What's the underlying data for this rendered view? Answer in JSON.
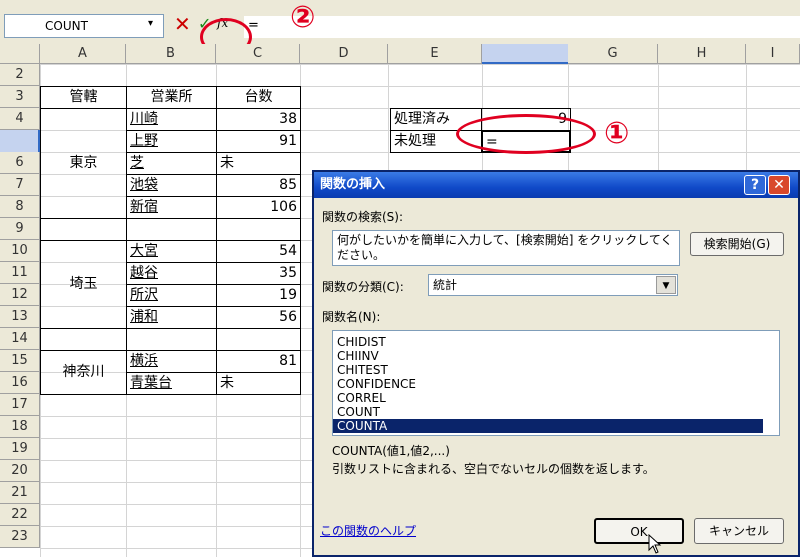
{
  "formula_bar": {
    "name_box": "COUNT",
    "dropdown_glyph": "▾",
    "cancel_glyph": "✕",
    "enter_glyph": "✓",
    "fx_label": "fx",
    "formula": "=",
    "marker": "②"
  },
  "columns": [
    "A",
    "B",
    "C",
    "D",
    "E",
    "F",
    "G",
    "H",
    "I"
  ],
  "rows": [
    "2",
    "3",
    "4",
    "5",
    "6",
    "7",
    "8",
    "9",
    "10",
    "11",
    "12",
    "13",
    "14",
    "15",
    "16",
    "17",
    "18",
    "19",
    "20",
    "21",
    "22",
    "23"
  ],
  "table": {
    "header_kankatsu": "管轄",
    "header_eigyosho": "営業所",
    "header_daisu": "台数",
    "region_tokyo": "東京",
    "region_saitama": "埼玉",
    "region_kanagawa": "神奈川",
    "office_1": "川崎",
    "count_1": "38",
    "office_2": "上野",
    "count_2": "91",
    "office_3": "芝",
    "count_3": "未",
    "office_4": "池袋",
    "count_4": "85",
    "office_5": "新宿",
    "count_5": "106",
    "office_6": "大宮",
    "count_6": "54",
    "office_7": "越谷",
    "count_7": "35",
    "office_8": "所沢",
    "count_8": "19",
    "office_9": "浦和",
    "count_9": "56",
    "office_10": "横浜",
    "count_10": "81",
    "office_11": "青葉台",
    "count_11": "未"
  },
  "summary": {
    "processed_label": "処理済み",
    "processed_value": "9",
    "unprocessed_label": "未処理",
    "unprocessed_value": "=",
    "marker": "①"
  },
  "dialog": {
    "title": "関数の挿入",
    "help_glyph": "?",
    "close_glyph": "✕",
    "search_label": "関数の検索(S):",
    "search_text": "何がしたいかを簡単に入力して、[検索開始] をクリックしてください。",
    "search_button": "検索開始(G)",
    "category_label": "関数の分類(C):",
    "category_value": "統計",
    "select_arrow": "▼",
    "func_name_label": "関数名(N):",
    "functions": [
      "CHIDIST",
      "CHIINV",
      "CHITEST",
      "CONFIDENCE",
      "CORREL",
      "COUNT",
      "COUNTA"
    ],
    "selected_function": "COUNTA",
    "scroll_up": "▲",
    "scroll_down": "▼",
    "syntax": "COUNTA(値1,値2,...)",
    "description": "引数リストに含まれる、空白でないセルの個数を返します。",
    "help_link": "この関数のヘルプ",
    "ok_button": "OK",
    "cancel_button": "キャンセル"
  }
}
